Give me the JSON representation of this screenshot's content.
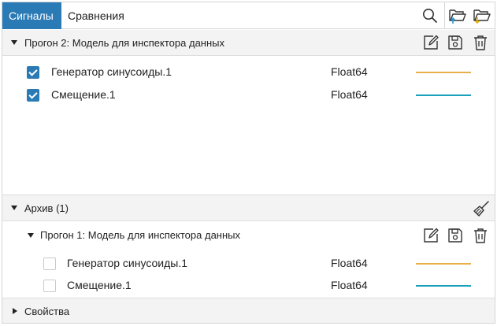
{
  "tabs": [
    {
      "label": "Сигналы",
      "active": true
    },
    {
      "label": "Сравнения",
      "active": false
    }
  ],
  "toolbar_icons": [
    "search-icon",
    "folder-open-upload-icon",
    "folder-open-download-icon"
  ],
  "run2": {
    "title": "Прогон 2: Модель для инспектора данных",
    "actions": [
      "edit-icon",
      "save-icon",
      "delete-icon"
    ],
    "signals": [
      {
        "name": "Генератор синусоиды.1",
        "type": "Float64",
        "checked": true,
        "color": "#e8b04a"
      },
      {
        "name": "Смещение.1",
        "type": "Float64",
        "checked": true,
        "color": "#1aa0b8"
      }
    ]
  },
  "archive": {
    "title": "Архив",
    "count": "(1)",
    "action": "broom-icon",
    "run1": {
      "title": "Прогон 1: Модель для инспектора данных",
      "actions": [
        "edit-icon",
        "save-icon",
        "delete-icon"
      ],
      "signals": [
        {
          "name": "Генератор синусоиды.1",
          "type": "Float64",
          "checked": false,
          "color": "#e8b04a"
        },
        {
          "name": "Смещение.1",
          "type": "Float64",
          "checked": false,
          "color": "#1aa0b8"
        }
      ]
    }
  },
  "properties": {
    "title": "Свойства"
  },
  "colors": {
    "accent": "#2a7ab5",
    "upload_arrow": "#2a9bd0",
    "download_arrow": "#e8b400"
  }
}
